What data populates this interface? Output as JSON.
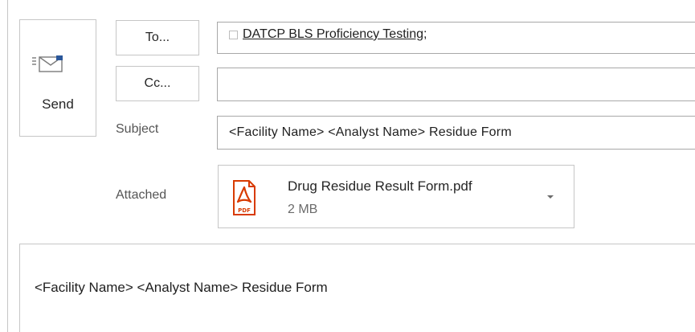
{
  "compose": {
    "send_label": "Send",
    "to_button_label": "To...",
    "cc_button_label": "Cc...",
    "to_recipients": [
      "DATCP BLS Proficiency Testing;"
    ],
    "cc_value": "",
    "subject_label": "Subject",
    "subject_value": "<Facility Name> <Analyst Name>  Residue Form",
    "attached_label": "Attached",
    "attachment": {
      "name": "Drug Residue Result Form.pdf",
      "size": "2 MB",
      "icon": "pdf-icon",
      "icon_text": "PDF"
    },
    "body_text": "<Facility Name> <Analyst Name> Residue Form"
  },
  "colors": {
    "border": "#c6c6c6",
    "pdf_red": "#d83b01",
    "envelope_blue": "#2b579a"
  }
}
